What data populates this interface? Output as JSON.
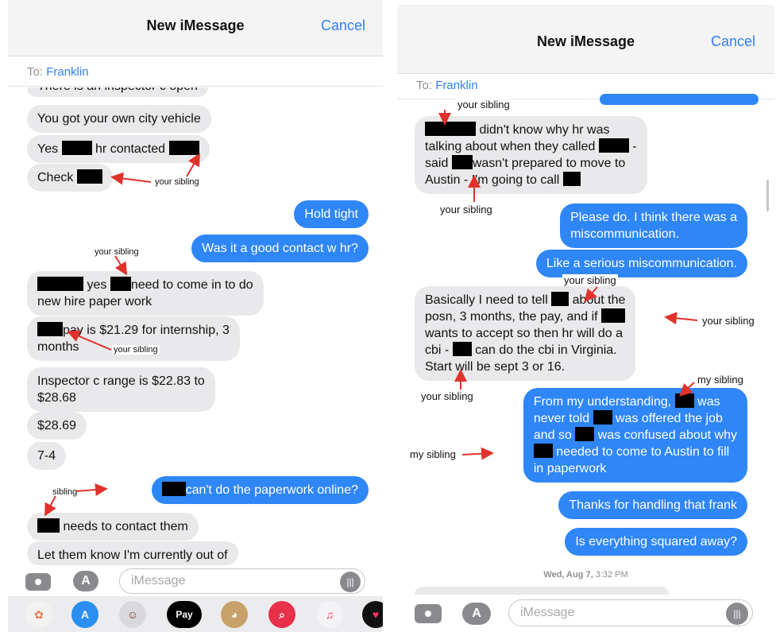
{
  "left": {
    "header": {
      "title": "New iMessage",
      "cancel": "Cancel"
    },
    "to": {
      "label": "To:",
      "name": "Franklin"
    },
    "messages": {
      "m0": "There is an inspector c open",
      "m1": "You got your own city vehicle",
      "m2a": "Yes",
      "m2b": "hr contacted",
      "m3": "Check",
      "m4": "Hold tight",
      "m5": "Was it a good contact w hr?",
      "m6a": "yes",
      "m6b": "need to come in to do",
      "m6c": "new hire paper work",
      "m7a": "pay is $21.29 for internship, 3",
      "m7b": "months",
      "m8a": "Inspector c range is $22.83 to",
      "m8b": "$28.68",
      "m9": "$28.69",
      "m10": "7-4",
      "m11": "can't do the paperwork online?",
      "m12": "needs to contact them",
      "m13": "Let them know I'm currently out of"
    },
    "annotations": {
      "a1": "your sibling",
      "a2": "your sibling",
      "a3": "your sibling",
      "a4": "sibling"
    },
    "compose": {
      "placeholder": "iMessage"
    },
    "dock": {
      "pay_label": "Pay"
    }
  },
  "right": {
    "header": {
      "title": "New iMessage",
      "cancel": "Cancel"
    },
    "to": {
      "label": "To:",
      "name": "Franklin"
    },
    "messages": {
      "r1a": "didn't know why hr was",
      "r1b": "talking about when they called",
      "r1c": "said",
      "r1d": "wasn't prepared to move to",
      "r1e": "Austin - I'm going to call",
      "r2a": "Please do. I think there was a",
      "r2b": "miscommunication.",
      "r3": "Like a serious miscommunication.",
      "r4a": "Basically I need to tell",
      "r4b": "about the",
      "r4c": "posn, 3 months, the pay, and if",
      "r4d": "wants to accept so then hr will do a",
      "r4e": "cbi -",
      "r4f": "can do the cbi in Virginia.",
      "r4g": "Start will be sept 3 or 16.",
      "r5a": "From my understanding,",
      "r5b": "was",
      "r5c": "never told",
      "r5d": "was offered the job",
      "r5e": "and so",
      "r5f": "was confused about why",
      "r5g": "needed to come to Austin to fill",
      "r5h": "in paperwork",
      "r6": "Thanks for handling that frank",
      "r7": "Is everything squared away?"
    },
    "timestamp": {
      "day": "Wed, Aug 7,",
      "time": "3:32 PM"
    },
    "annotations": {
      "b1": "your sibling",
      "b2": "your sibling",
      "b3": "your sibling",
      "b4": "your sibling",
      "b5": "your sibling",
      "b6": "my sibling",
      "b7": "my sibling"
    },
    "compose": {
      "placeholder": "iMessage"
    }
  },
  "colors": {
    "outgoing": "#2f86f6",
    "incoming": "#e9e9eb",
    "link": "#2f7ff0",
    "arrow": "#e0322b"
  },
  "icons": [
    "camera-icon",
    "app-store-icon",
    "microphone-icon",
    "photos-icon",
    "memoji-icon",
    "apple-pay-icon",
    "monkey-icon",
    "search-icon",
    "music-icon"
  ]
}
